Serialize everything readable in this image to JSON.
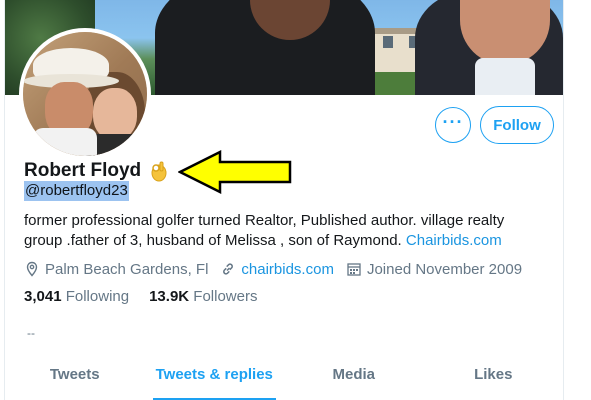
{
  "profile": {
    "name": "Robert Floyd",
    "name_emoji": "👌",
    "handle": "@robertfloyd23",
    "bio_text": "former professional golfer turned Realtor, Published author. village realty group .father of 3, husband of Melissa , son of Raymond.",
    "bio_link": "Chairbids.com",
    "location": "Palm Beach Gardens, Fl",
    "website": "chairbids.com",
    "joined": "Joined November 2009",
    "following_count": "3,041",
    "following_label": "Following",
    "followers_count": "13.9K",
    "followers_label": "Followers",
    "dash": "--"
  },
  "actions": {
    "more_label": "···",
    "follow_label": "Follow"
  },
  "tabs": [
    {
      "label": "Tweets",
      "active": false
    },
    {
      "label": "Tweets & replies",
      "active": true
    },
    {
      "label": "Media",
      "active": false
    },
    {
      "label": "Likes",
      "active": false
    }
  ],
  "colors": {
    "accent": "#1da1f2",
    "link": "#1b95e0",
    "highlight": "#9cc3f0",
    "arrow_fill": "#ffff00",
    "secondary_text": "#657786"
  },
  "icons": [
    "location-icon",
    "link-icon",
    "calendar-icon",
    "ok-hand-icon",
    "arrow-icon"
  ]
}
